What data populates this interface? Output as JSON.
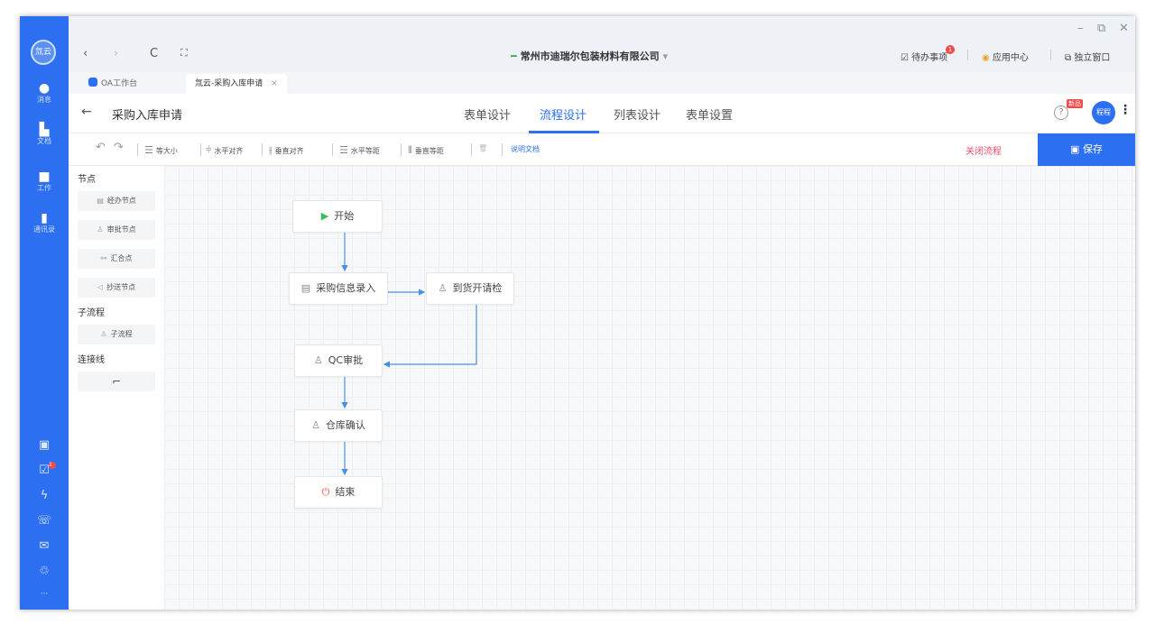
{
  "window": {
    "minimize": "–",
    "restore": "⧉",
    "close": "✕"
  },
  "browser": {
    "back": "‹",
    "forward": "›",
    "reload": "C",
    "fullscreen": "⛶",
    "company": "常州市迪瑞尔包装材料有限公司"
  },
  "toplinks": {
    "todo": "待办事项",
    "todo_badge": "1",
    "app_center": "应用中心",
    "standalone": "独立窗口"
  },
  "tabs": [
    {
      "label": "OA工作台"
    },
    {
      "label": "氚云-采购入库申请",
      "close": "×"
    }
  ],
  "sidenav": {
    "logo": "氚云",
    "items": [
      {
        "label": "消息"
      },
      {
        "label": "文档"
      },
      {
        "label": "工作"
      },
      {
        "label": "通讯录"
      }
    ],
    "bottom_badge": "1",
    "more": "···"
  },
  "title": {
    "back": "←",
    "text": "采购入库申请",
    "user": "程程",
    "new_badge": "新品",
    "help": "?",
    "more": "⋮"
  },
  "design_tabs": [
    {
      "label": "表单设计"
    },
    {
      "label": "流程设计"
    },
    {
      "label": "列表设计"
    },
    {
      "label": "表单设置"
    }
  ],
  "toolbar": {
    "undo": "↶",
    "redo": "↷",
    "same_size": "等大小",
    "h_align": "水平对齐",
    "v_align": "垂直对齐",
    "h_space": "水平等距",
    "v_space": "垂直等距",
    "delete": "🗑",
    "doc": "说明文档",
    "close_flow": "关闭流程",
    "save": "保存"
  },
  "palette": {
    "nodes_header": "节点",
    "nodes": [
      {
        "label": "经办节点"
      },
      {
        "label": "审批节点"
      },
      {
        "label": "汇合点"
      },
      {
        "label": "抄送节点"
      }
    ],
    "subflow_header": "子流程",
    "subflow": [
      {
        "label": "子流程"
      }
    ],
    "connector_header": "连接线",
    "connector_symbol": "⌐"
  },
  "flow": {
    "nodes": [
      {
        "label": "开始",
        "icon": "play-icon"
      },
      {
        "label": "采购信息录入",
        "icon": "form-icon"
      },
      {
        "label": "到货开请检",
        "icon": "user-icon"
      },
      {
        "label": "QC审批",
        "icon": "user-icon"
      },
      {
        "label": "仓库确认",
        "icon": "user-icon"
      },
      {
        "label": "结束",
        "icon": "power-icon"
      }
    ]
  },
  "colors": {
    "primary": "#2c6ff0",
    "danger": "#f04a6a",
    "start": "#3aba5a",
    "edge": "#4a90e2"
  }
}
